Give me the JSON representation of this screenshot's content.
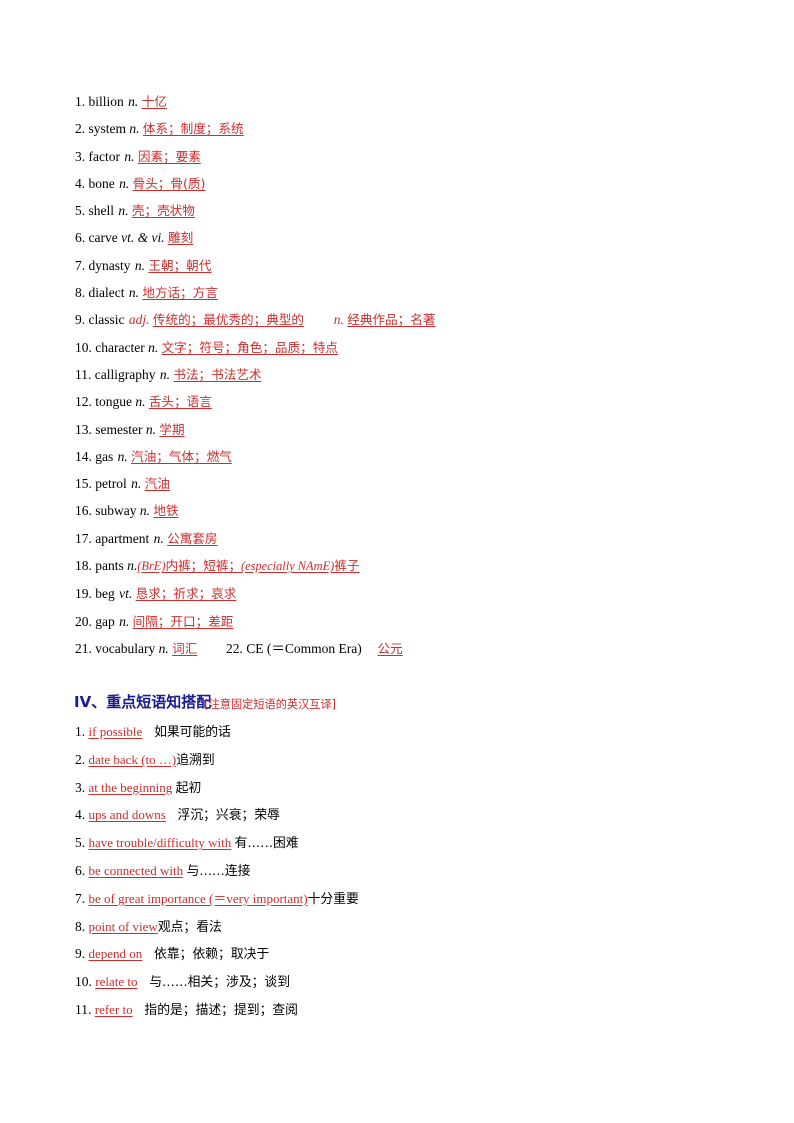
{
  "document": {
    "page_background": "#ffffff",
    "accent_red": "#cc2d2d",
    "heading_navy": "#1b1b8f"
  },
  "word_list": {
    "items": [
      {
        "num": "1.",
        "word": "billion",
        "pos": "n.",
        "meaning": "十亿"
      },
      {
        "num": "2.",
        "word": "system",
        "pos": "n.",
        "meaning": "体系；制度；系统"
      },
      {
        "num": "3.",
        "word": "factor",
        "pos": "n.",
        "meaning": "因素；要素"
      },
      {
        "num": "4.",
        "word": "bone",
        "pos": "n.",
        "meaning": "骨头；骨(质)"
      },
      {
        "num": "5.",
        "word": "shell",
        "pos": "n.",
        "meaning": "壳；壳状物"
      },
      {
        "num": "6.",
        "word": "carve",
        "pos": "vt. & vi.",
        "meaning": "雕刻"
      },
      {
        "num": "7.",
        "word": "dynasty",
        "pos": "n.",
        "meaning": "王朝；朝代"
      },
      {
        "num": "8.",
        "word": "dialect",
        "pos": "n.",
        "meaning": "地方话；方言"
      },
      {
        "num": "9.",
        "word": "classic",
        "pos": "adj.",
        "meaning": "传统的；最优秀的；典型的",
        "pos2": "n.",
        "meaning2": "经典作品；名著"
      },
      {
        "num": "10.",
        "word": "character",
        "pos": "n.",
        "meaning": "文字；符号；角色；品质；特点"
      },
      {
        "num": "11.",
        "word": "calligraphy",
        "pos": "n.",
        "meaning": "书法；书法艺术"
      },
      {
        "num": "12.",
        "word": "tongue",
        "pos": "n.",
        "meaning": "舌头；语言"
      },
      {
        "num": "13.",
        "word": "semester",
        "pos": "n.",
        "meaning": "学期"
      },
      {
        "num": "14.",
        "word": "gas",
        "pos": "n.",
        "meaning": "汽油；气体；燃气"
      },
      {
        "num": "15.",
        "word": "petrol",
        "pos": "n.",
        "meaning": "汽油"
      },
      {
        "num": "16.",
        "word": "subway",
        "pos": "n.",
        "meaning": "地铁"
      },
      {
        "num": "17.",
        "word": "apartment",
        "pos": "n.",
        "meaning": "公寓套房"
      },
      {
        "num": "18.",
        "word": "pants",
        "pos": "n.",
        "meaning_pre_reg": "(BrE)",
        "meaning_mid": "内裤；短裤；",
        "meaning_reg2": "(especially NAmE)",
        "meaning_post": "裤子"
      },
      {
        "num": "19.",
        "word": "beg",
        "pos": "vt.",
        "meaning": "恳求；祈求；哀求"
      },
      {
        "num": "20.",
        "word": "gap",
        "pos": "n.",
        "meaning": "间隔；开口；差距"
      },
      {
        "num": "21.",
        "word": "vocabulary",
        "pos": "n.",
        "meaning": "词汇",
        "num_b": "22.",
        "word_b": "CE (＝Common Era)",
        "meaning_b": "公元"
      }
    ]
  },
  "heading": {
    "title": "IV、重点短语知搭配",
    "note": "[注意固定短语的英汉互译]"
  },
  "phrase_list": {
    "items": [
      {
        "num": "1.",
        "english": "if possible",
        "chinese": "如果可能的话"
      },
      {
        "num": "2.",
        "english": "date back (to …)",
        "chinese": "追溯到"
      },
      {
        "num": "3.",
        "english": "at the beginning",
        "chinese": "起初"
      },
      {
        "num": "4.",
        "english": "ups and downs",
        "chinese": "浮沉；兴衰；荣辱"
      },
      {
        "num": "5.",
        "english": "have trouble/difficulty with",
        "chinese": "有……困难"
      },
      {
        "num": "6.",
        "english": "be connected with",
        "chinese": "与……连接"
      },
      {
        "num": "7.",
        "english": "be of great importance (＝very important)",
        "chinese": "十分重要"
      },
      {
        "num": "8.",
        "english": "point of view",
        "chinese": "观点；看法"
      },
      {
        "num": "9.",
        "english": "depend on",
        "chinese": "依靠；依赖；取决于"
      },
      {
        "num": "10.",
        "english": "relate to",
        "chinese": "与……相关；涉及；谈到"
      },
      {
        "num": "11.",
        "english": "refer to",
        "chinese": "指的是；描述；提到；查阅"
      }
    ]
  }
}
